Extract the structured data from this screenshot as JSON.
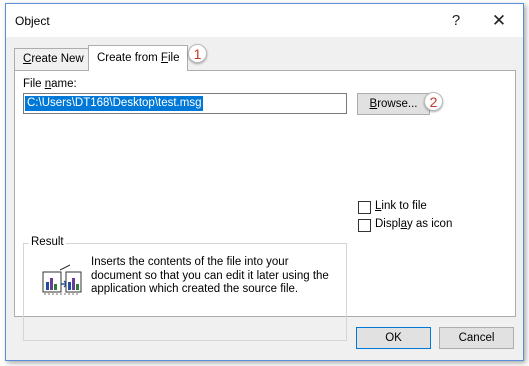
{
  "window": {
    "title": "Object",
    "help_glyph": "?",
    "close_glyph": "✕"
  },
  "tabs": [
    {
      "label_underlined": "C",
      "label_rest": "reate New",
      "active": false
    },
    {
      "label_prefix": "Create from ",
      "label_underlined": "F",
      "label_rest": "ile",
      "active": true
    }
  ],
  "file_name": {
    "label_prefix": "File ",
    "label_underlined": "n",
    "label_rest": "ame:",
    "value": "C:\\Users\\DT168\\Desktop\\test.msg"
  },
  "browse": {
    "label_underlined": "B",
    "label_rest": "rowse..."
  },
  "markers": [
    "1",
    "2"
  ],
  "checkboxes": {
    "link": {
      "label_underlined": "L",
      "label_rest": "ink to file",
      "checked": false
    },
    "icon": {
      "label_prefix": "Displ",
      "label_underlined": "a",
      "label_rest": "y as icon",
      "checked": false
    }
  },
  "result": {
    "title": "Result",
    "text": "Inserts the contents of the file into your document so that you can edit it later using the application which created the source file.",
    "icon": "embed-object-icon"
  },
  "buttons": {
    "ok": "OK",
    "cancel": "Cancel"
  },
  "colors": {
    "accent": "#0078d7",
    "border": "#5b8ed6",
    "marker": "#c0392b"
  }
}
